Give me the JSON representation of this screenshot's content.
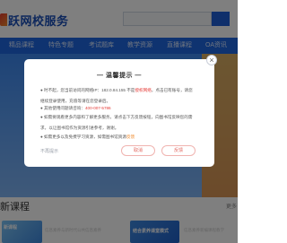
{
  "header": {
    "logo_text": "跃网校服务"
  },
  "nav": {
    "items": [
      "精品课程",
      "特色专题",
      "考试题库",
      "教学资源",
      "直播课程",
      "OA资讯"
    ]
  },
  "modal": {
    "close": "×",
    "title": "— 温馨提示 —",
    "line1_a": "● 时不起，您当前访问的网络IP：182.0.84.155 不是",
    "line1_b": "授权网络",
    "line1_c": "，点击已有账号，请您",
    "line2": "继续登录使用，充值等请在您登录后。",
    "line3_a": "● 其他使用问题请咨询：",
    "line3_b": "400-007-5786",
    "line4": "● 如需要观看更多内容和了解更多服务，请点击下方反馈按钮，向图书馆反映您的需",
    "line5": "求，以让图书馆作为资源引进参考，谢谢。",
    "line6_a": "● 如需更多以及免费学习资源，如需图书馆资源",
    "line6_b": "反馈",
    "dont_show": "不再提示",
    "cancel_label": "取消",
    "ok_label": "反馈"
  },
  "content": {
    "section_title": "新课程",
    "more": "更多",
    "card1_label": "新课程",
    "card1_text": "信息素养与新时代公共信息素养",
    "card2_label": "结合素养课堂模式",
    "card2_text": "信息素养新编课程教学"
  }
}
